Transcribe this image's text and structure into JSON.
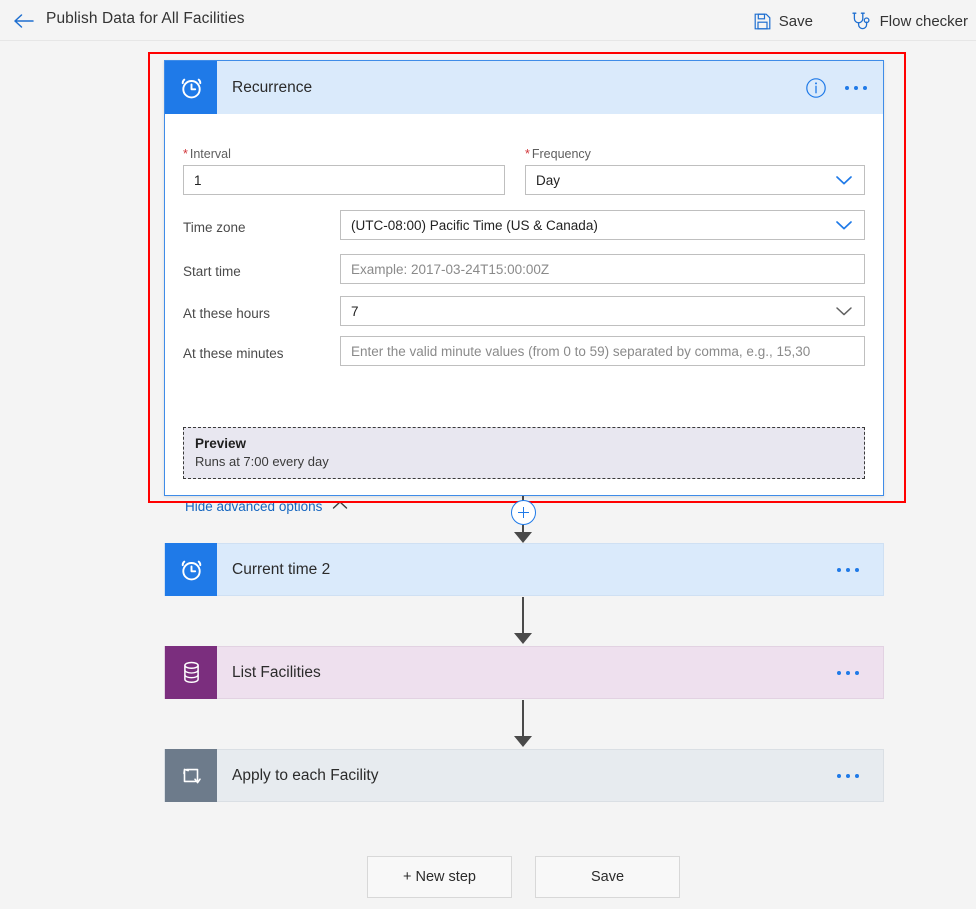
{
  "topbar": {
    "back_icon": "back-arrow-icon",
    "title": "Publish Data for All Facilities",
    "commands": [
      {
        "id": "save",
        "label": "Save",
        "icon": "save-disk-icon"
      },
      {
        "id": "flow_checker",
        "label": "Flow checker",
        "icon": "stethoscope-icon"
      }
    ]
  },
  "annotation": {
    "highlight_color": "#ff0000",
    "target": "recurrence-card"
  },
  "flow": {
    "trigger": {
      "title": "Recurrence",
      "icon": "alarm-clock-icon",
      "selected": true,
      "header_color": "#daeafb",
      "tile_color": "#1f7ae8",
      "info_icon": "info-circle-icon",
      "menu_icon": "ellipsis-icon",
      "fields": {
        "interval": {
          "label": "Interval",
          "required": true,
          "value": "1"
        },
        "frequency": {
          "label": "Frequency",
          "required": true,
          "value": "Day"
        },
        "time_zone": {
          "label": "Time zone",
          "required": false,
          "value": "(UTC-08:00) Pacific Time (US & Canada)"
        },
        "start_time": {
          "label": "Start time",
          "required": false,
          "value": "",
          "placeholder": "Example: 2017-03-24T15:00:00Z"
        },
        "at_these_hours": {
          "label": "At these hours",
          "required": false,
          "value": "7"
        },
        "at_these_minutes": {
          "label": "At these minutes",
          "required": false,
          "value": "",
          "placeholder": "Enter the valid minute values (from 0 to 59) separated by comma, e.g., 15,30"
        }
      },
      "preview": {
        "title": "Preview",
        "text": "Runs at 7:00 every day"
      },
      "advanced_toggle": {
        "label": "Hide advanced options",
        "icon": "chevron-up-icon",
        "expanded": true
      }
    },
    "add_step_button": {
      "icon": "plus-circle-icon",
      "label": "+"
    },
    "steps": [
      {
        "id": "current_time_2",
        "title": "Current time 2",
        "icon": "alarm-clock-icon",
        "tile_color": "#1f7ae8",
        "body_color": "#daeafb",
        "menu_icon": "ellipsis-icon"
      },
      {
        "id": "list_facilities",
        "title": "List Facilities",
        "icon": "database-icon",
        "tile_color": "#7b2e7e",
        "body_color": "#eee0ee",
        "menu_icon": "ellipsis-icon"
      },
      {
        "id": "apply_to_each_facility",
        "title": "Apply to each Facility",
        "icon": "loop-foreach-icon",
        "tile_color": "#6d7b8b",
        "body_color": "#e7ebef",
        "menu_icon": "ellipsis-icon"
      }
    ]
  },
  "footer": {
    "new_step_label": "+ New step",
    "save_label": "Save"
  }
}
